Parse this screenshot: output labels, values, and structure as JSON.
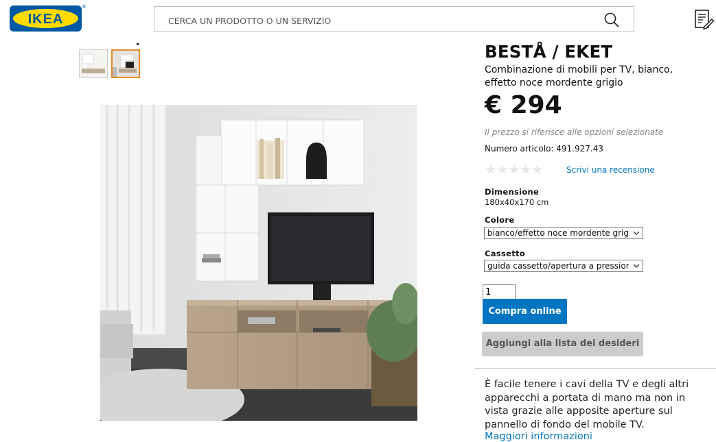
{
  "header": {
    "logo_text": "IKEA",
    "registered_mark": "®",
    "search": {
      "placeholder": "CERCA UN PRODOTTO O UN SERVIZIO",
      "icon": "search-icon"
    },
    "shopping_list_icon": "shopping-list-icon"
  },
  "gallery": {
    "thumbnails": [
      {
        "label": "thumbnail-1",
        "selected": false
      },
      {
        "label": "thumbnail-2",
        "selected": true
      }
    ]
  },
  "product": {
    "name": "BESTÅ / EKET",
    "description": "Combinazione di mobili per TV, bianco, effetto noce mordente grigio",
    "price": "€ 294",
    "price_note": "Il prezzo si riferisce alle opzioni selezionate",
    "article_number": "Numero articolo: 491.927.43",
    "rating_stars": "★★★★★",
    "rating_value": 0,
    "review_link": "Scrivi una recensione",
    "dimension_label": "Dimensione",
    "dimension_value": "180x40x170 cm",
    "color_label": "Colore",
    "color_selected": "bianco/effetto noce mordente grigio",
    "drawer_label": "Cassetto",
    "drawer_selected": "guida cassetto/apertura a pressione",
    "quantity": "1",
    "buy_button": "Compra online",
    "wishlist_button": "Aggiungi alla lista dei desideri",
    "long_description": "È facile tenere i cavi della TV e degli altri apparecchi a portata di mano ma non in vista grazie alle apposite aperture sul pannello di fondo del mobile TV.",
    "more_info_link": "Maggiori informazioni"
  },
  "colors": {
    "ikea_blue": "#0058a3",
    "ikea_yellow": "#ffdb00",
    "link_blue": "#0075c2",
    "buy_button_bg": "#0075c2",
    "wishlist_button_bg": "#cccccc",
    "thumbnail_selected_border": "#e58c2a"
  }
}
